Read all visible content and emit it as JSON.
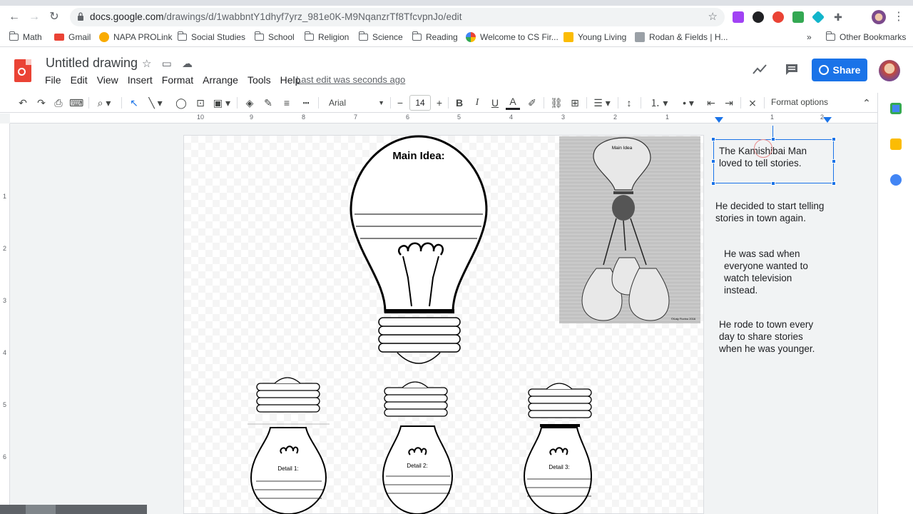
{
  "browser": {
    "url_host": "docs.google.com",
    "url_path": "/drawings/d/1wabbntY1dhyf7yrz_981e0K-M9NqanzrTf8TfcvpnJo/edit",
    "bookmarks": [
      "Math",
      "Gmail",
      "NAPA PROLink",
      "Social Studies",
      "School",
      "Religion",
      "Science",
      "Reading",
      "Welcome to CS Fir...",
      "Young Living",
      "Rodan & Fields | H..."
    ],
    "overflow": "»",
    "other_bookmarks": "Other Bookmarks"
  },
  "header": {
    "title": "Untitled drawing",
    "menu": [
      "File",
      "Edit",
      "View",
      "Insert",
      "Format",
      "Arrange",
      "Tools",
      "Help"
    ],
    "last_edit": "Last edit was seconds ago",
    "share_label": "Share"
  },
  "toolbar": {
    "font": "Arial",
    "font_size": "14",
    "format_options": "Format options"
  },
  "ruler": {
    "h_ticks": [
      "10",
      "9",
      "8",
      "7",
      "6",
      "5",
      "4",
      "3",
      "2",
      "1",
      "1",
      "2"
    ],
    "v_ticks": [
      "1",
      "2",
      "3",
      "4",
      "5",
      "6"
    ]
  },
  "drawing": {
    "main_idea_label": "Main Idea:",
    "details": [
      "Detail 1:",
      "Detail 2:",
      "Detail 3:"
    ],
    "photo_main_label": "Main Idea",
    "photo_credit": "©Katy Fiorino 2016"
  },
  "text_boxes": [
    "The Kamishibai Man\nloved to tell stories.",
    "He decided to start telling\nstories in town again.",
    "He was sad when\neveryone wanted to\nwatch television\ninstead.",
    "He rode to town every\nday to share stories\nwhen he was younger."
  ],
  "colors": {
    "accent": "#1a73e8",
    "docs_red": "#ea4335"
  }
}
